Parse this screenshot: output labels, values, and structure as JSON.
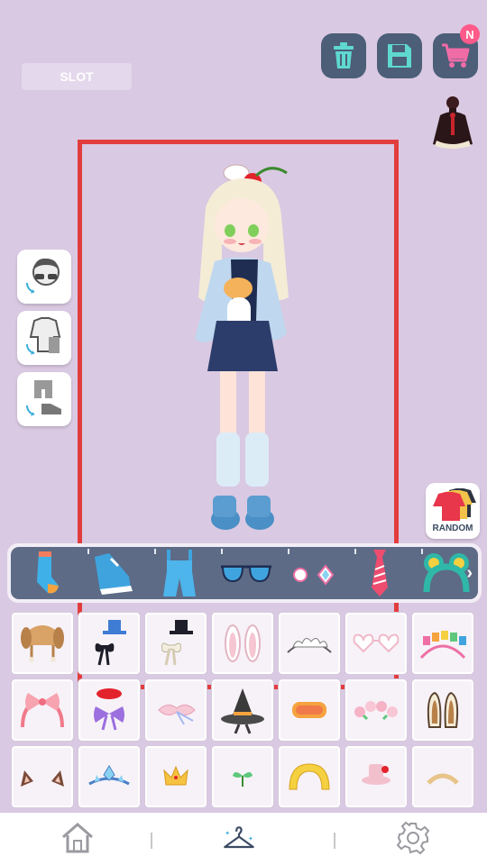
{
  "header": {
    "slot_label": "SLOT",
    "new_badge": "N"
  },
  "toolbar": {
    "delete_icon": "trash-icon",
    "save_icon": "floppy-disk-icon",
    "shop_icon": "shopping-cart-icon"
  },
  "side_buttons": [
    "face-swap",
    "top-swap",
    "bottom-swap"
  ],
  "random_label": "RANDOM",
  "categories": [
    "socks",
    "shoes",
    "overalls",
    "glasses",
    "earrings",
    "tie",
    "headband"
  ],
  "items_grid": {
    "rows": 3,
    "columns": 7
  },
  "bottom_nav": [
    "home",
    "closet",
    "settings"
  ],
  "colors": {
    "background": "#d9c9e2",
    "toolbar_button": "#4c5e78",
    "trash": "#5fd8d0",
    "save": "#5fd8d0",
    "cart": "#f06ca7",
    "frame": "#e23d3d",
    "category_bar": "#5d6b86",
    "nav_active": "#3b4a63"
  }
}
